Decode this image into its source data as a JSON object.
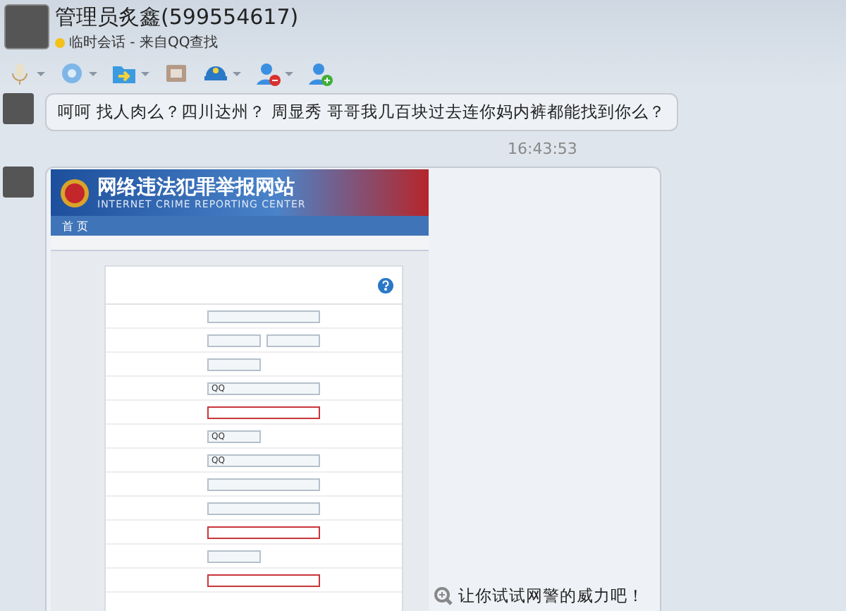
{
  "contact": {
    "name": "管理员炙鑫(599554617)",
    "status": "临时会话 - 来自QQ查找"
  },
  "messages": [
    {
      "kind": "text",
      "text": "呵呵 找人肉么？四川达州？ 周显秀 哥哥我几百块过去连你妈内裤都能找到你么？"
    },
    {
      "kind": "time",
      "text": "16:43:53"
    },
    {
      "kind": "image",
      "caption": "让你试试网警的威力吧！",
      "screenshot": {
        "title": "网络违法犯罪举报网站",
        "subtitle": "INTERNET CRIME REPORTING CENTER",
        "nav": [
          "首 页"
        ],
        "fields": [
          {
            "kind": "input",
            "error": false
          },
          {
            "kind": "pair",
            "error": false
          },
          {
            "kind": "select",
            "error": false
          },
          {
            "kind": "input",
            "error": false,
            "value": "QQ"
          },
          {
            "kind": "input",
            "error": true
          },
          {
            "kind": "select",
            "error": false,
            "value": "QQ"
          },
          {
            "kind": "input",
            "error": false,
            "value": "QQ"
          },
          {
            "kind": "input",
            "error": false
          },
          {
            "kind": "input",
            "error": false
          },
          {
            "kind": "input",
            "error": true
          },
          {
            "kind": "select",
            "error": false
          },
          {
            "kind": "input",
            "error": true
          }
        ]
      }
    }
  ]
}
